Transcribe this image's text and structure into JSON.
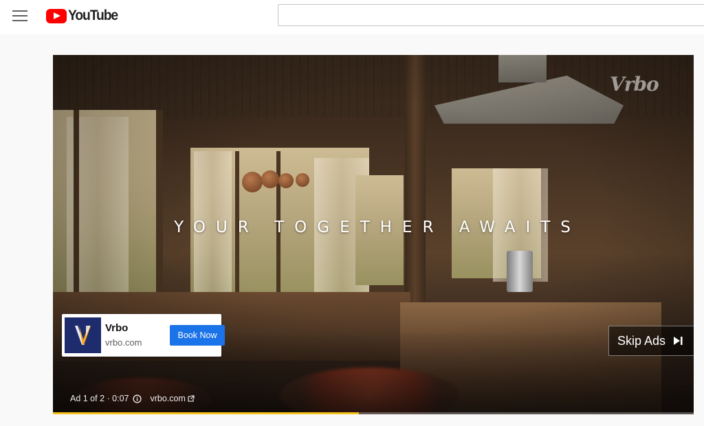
{
  "header": {
    "logo_text": "YouTube",
    "search_placeholder": ""
  },
  "video": {
    "watermark": "Vrbo",
    "headline": "YOUR TOGETHER AWAITS"
  },
  "ad_card": {
    "advertiser": "Vrbo",
    "url": "vrbo.com",
    "cta_label": "Book Now",
    "cta_color": "#1a73e8"
  },
  "skip": {
    "label": "Skip Ads"
  },
  "ad_info": {
    "position": "Ad 1 of 2 · 0:07",
    "link": "vrbo.com"
  },
  "progress": {
    "fraction": 0.477,
    "color": "#f6c31b"
  },
  "colors": {
    "brand_red": "#ff0000",
    "vrbo_navy": "#1e2c6e"
  }
}
